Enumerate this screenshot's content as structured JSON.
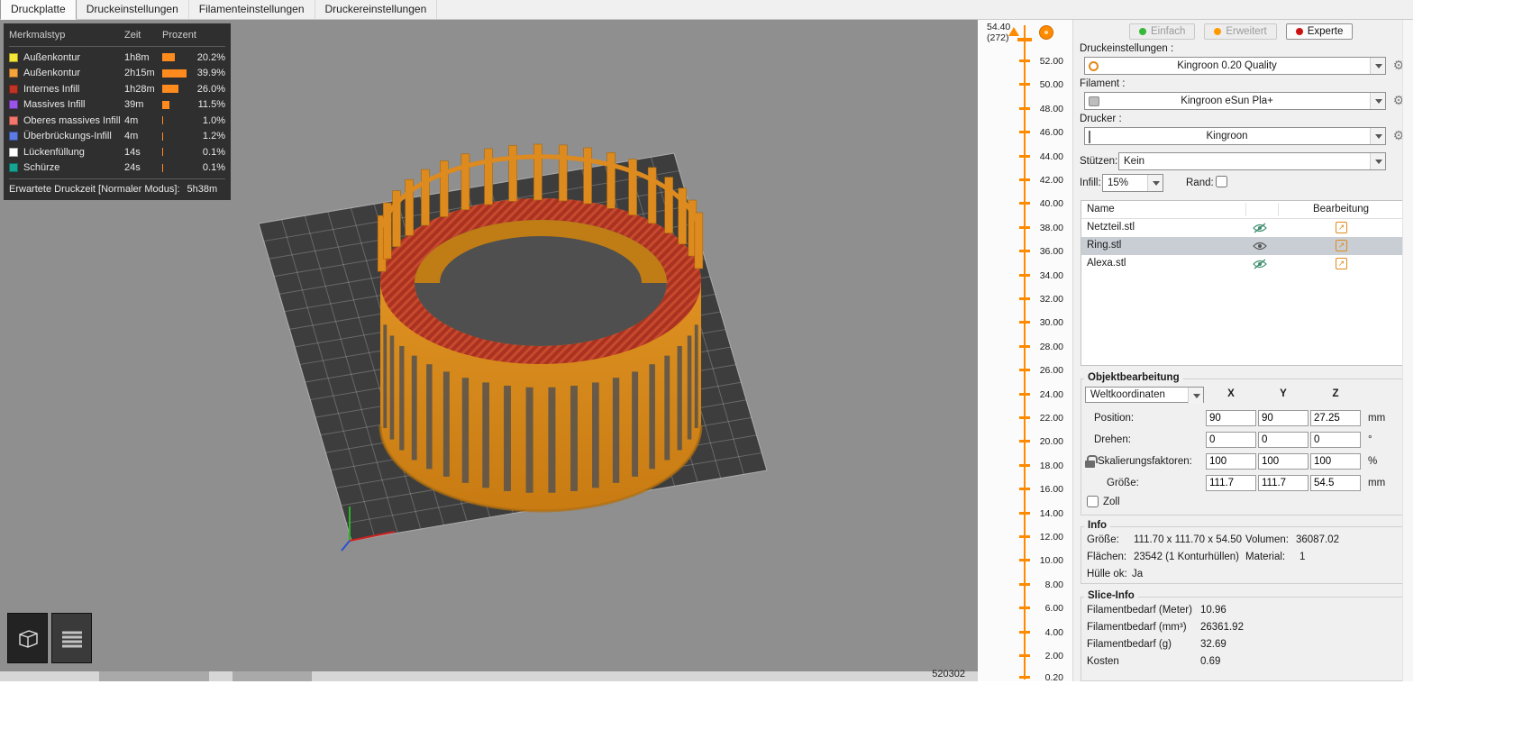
{
  "tabs": [
    {
      "label": "Druckplatte",
      "active": true
    },
    {
      "label": "Druckeinstellungen",
      "active": false
    },
    {
      "label": "Filamenteinstellungen",
      "active": false
    },
    {
      "label": "Druckereinstellungen",
      "active": false
    }
  ],
  "legend": {
    "headers": {
      "type": "Merkmalstyp",
      "time": "Zeit",
      "percent": "Prozent"
    },
    "rows": [
      {
        "label": "Außenkontur",
        "time": "1h8m",
        "percent": "20.2%",
        "pct": 20.2,
        "color": "#F4E738"
      },
      {
        "label": "Außenkontur",
        "time": "2h15m",
        "percent": "39.9%",
        "pct": 39.9,
        "color": "#F7A43B"
      },
      {
        "label": "Internes Infill",
        "time": "1h28m",
        "percent": "26.0%",
        "pct": 26.0,
        "color": "#BE3425"
      },
      {
        "label": "Massives Infill",
        "time": "39m",
        "percent": "11.5%",
        "pct": 11.5,
        "color": "#9B54E8"
      },
      {
        "label": "Oberes massives Infill",
        "time": "4m",
        "percent": "1.0%",
        "pct": 1.0,
        "color": "#F1766B"
      },
      {
        "label": "Überbrückungs-Infill",
        "time": "4m",
        "percent": "1.2%",
        "pct": 1.2,
        "color": "#5C7CE4"
      },
      {
        "label": "Lückenfüllung",
        "time": "14s",
        "percent": "0.1%",
        "pct": 0.1,
        "color": "#FFFFFF"
      },
      {
        "label": "Schürze",
        "time": "24s",
        "percent": "0.1%",
        "pct": 0.1,
        "color": "#16A394"
      }
    ],
    "footer_label": "Erwartete Druckzeit [Normaler Modus]:",
    "footer_value": "5h38m",
    "bar_color": "#FF8A1E"
  },
  "layer_slider": {
    "current": "54.40",
    "layer_number": "(272)",
    "accent_color": "#FF8A00",
    "ticks": [
      "52.00",
      "50.00",
      "48.00",
      "46.00",
      "44.00",
      "42.00",
      "40.00",
      "38.00",
      "36.00",
      "34.00",
      "32.00",
      "30.00",
      "28.00",
      "26.00",
      "24.00",
      "22.00",
      "20.00",
      "18.00",
      "16.00",
      "14.00",
      "12.00",
      "10.00",
      "8.00",
      "6.00",
      "4.00",
      "2.00",
      "0.20"
    ]
  },
  "bottom_bar": {
    "value": "520302"
  },
  "right_panel": {
    "modes": [
      {
        "label": "Einfach",
        "color": "#37B837",
        "active": false
      },
      {
        "label": "Erweitert",
        "color": "#FF9B00",
        "active": false
      },
      {
        "label": "Experte",
        "color": "#CC1111",
        "active": true
      }
    ],
    "print_settings": {
      "label": "Druckeinstellungen :",
      "value": "Kingroon 0.20 Quality"
    },
    "filament": {
      "label": "Filament :",
      "value": "Kingroon eSun Pla+"
    },
    "printer": {
      "label": "Drucker :",
      "value": "Kingroon"
    },
    "supports": {
      "label": "Stützen:",
      "value": "Kein"
    },
    "infill": {
      "label": "Infill:",
      "value": "15%"
    },
    "brim": {
      "label": "Rand:",
      "checked": false
    },
    "object_table": {
      "col_name": "Name",
      "col_edit": "Bearbeitung",
      "rows": [
        {
          "name": "Netzteil.stl",
          "visible": false,
          "selected": false
        },
        {
          "name": "Ring.stl",
          "visible": true,
          "selected": true
        },
        {
          "name": "Alexa.stl",
          "visible": false,
          "selected": false
        }
      ]
    },
    "object_manipulation": {
      "title": "Objektbearbeitung",
      "coord_system": "Weltkoordinaten",
      "axis_headers": [
        "X",
        "Y",
        "Z"
      ],
      "rows": [
        {
          "label": "Position:",
          "values": [
            "90",
            "90",
            "27.25"
          ],
          "unit": "mm"
        },
        {
          "label": "Drehen:",
          "values": [
            "0",
            "0",
            "0"
          ],
          "unit": "°"
        },
        {
          "label": "Skalierungsfaktoren:",
          "values": [
            "100",
            "100",
            "100"
          ],
          "unit": "%"
        },
        {
          "label": "Größe:",
          "values": [
            "111.7",
            "111.7",
            "54.5"
          ],
          "unit": "mm"
        }
      ],
      "inches_label": "Zoll"
    },
    "info": {
      "title": "Info",
      "size_label": "Größe:",
      "size_value": "111.70 x 111.70 x 54.50",
      "volume_label": "Volumen:",
      "volume_value": "36087.02",
      "facets_label": "Flächen:",
      "facets_value": "23542 (1 Konturhüllen)",
      "material_label": "Material:",
      "material_value": "1",
      "manifold_label": "Hülle ok:",
      "manifold_value": "Ja"
    },
    "slice_info": {
      "title": "Slice-Info",
      "rows": [
        {
          "label": "Filamentbedarf (Meter)",
          "value": "10.96"
        },
        {
          "label": "Filamentbedarf (mm³)",
          "value": "26361.92"
        },
        {
          "label": "Filamentbedarf (g)",
          "value": "32.69"
        },
        {
          "label": "Kosten",
          "value": "0.69"
        }
      ]
    }
  }
}
